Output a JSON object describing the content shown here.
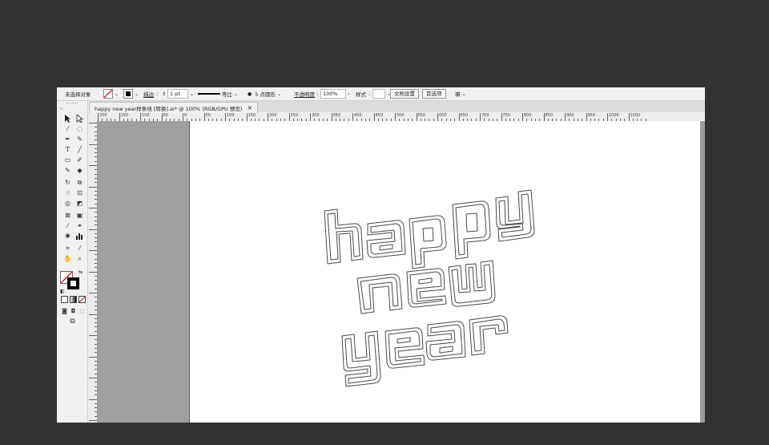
{
  "control_bar": {
    "selection_status": "未选择对象",
    "stroke_label": "描边",
    "stroke_weight": "1 pt",
    "profile": "等比",
    "brush": "5 点圆形",
    "opacity_label": "不透明度",
    "opacity_value": "100%",
    "style_label": "样式",
    "doc_setup_button": "文档设置",
    "preferences_button": "首选项"
  },
  "document_tab": {
    "title": "happy new year样条线 [转换].ai* @ 100% (RGB/GPU 预览)",
    "close_glyph": "×"
  },
  "ruler": {
    "h_labels": [
      "200",
      "150",
      "100",
      "50",
      "0",
      "50",
      "100",
      "150",
      "200",
      "250",
      "300",
      "350",
      "400",
      "450",
      "500",
      "550",
      "600",
      "650",
      "700",
      "750",
      "800",
      "850",
      "900",
      "950",
      "1000",
      "1050"
    ]
  },
  "artwork": {
    "lines": [
      "happy",
      "new",
      "year"
    ],
    "style": "double outline"
  },
  "colors": {
    "workspace": "#323232",
    "pasteboard": "#a0a0a0",
    "artboard": "#ffffff",
    "panel": "#f0f0f0",
    "stroke_swatch": "#d0021b"
  },
  "icons": [
    "selection-tool-icon",
    "direct-selection-tool-icon",
    "magic-wand-icon",
    "lasso-icon",
    "pen-icon",
    "curvature-icon",
    "type-icon",
    "line-icon",
    "rectangle-icon",
    "paintbrush-icon",
    "shaper-icon",
    "eraser-icon",
    "rotate-icon",
    "scale-icon",
    "warp-icon",
    "free-transform-icon",
    "shape-builder-icon",
    "perspective-icon",
    "mesh-icon",
    "gradient-icon",
    "eyedropper-icon",
    "blend-icon",
    "symbol-sprayer-icon",
    "column-graph-icon",
    "artboard-icon",
    "slice-icon",
    "hand-icon",
    "zoom-icon"
  ]
}
